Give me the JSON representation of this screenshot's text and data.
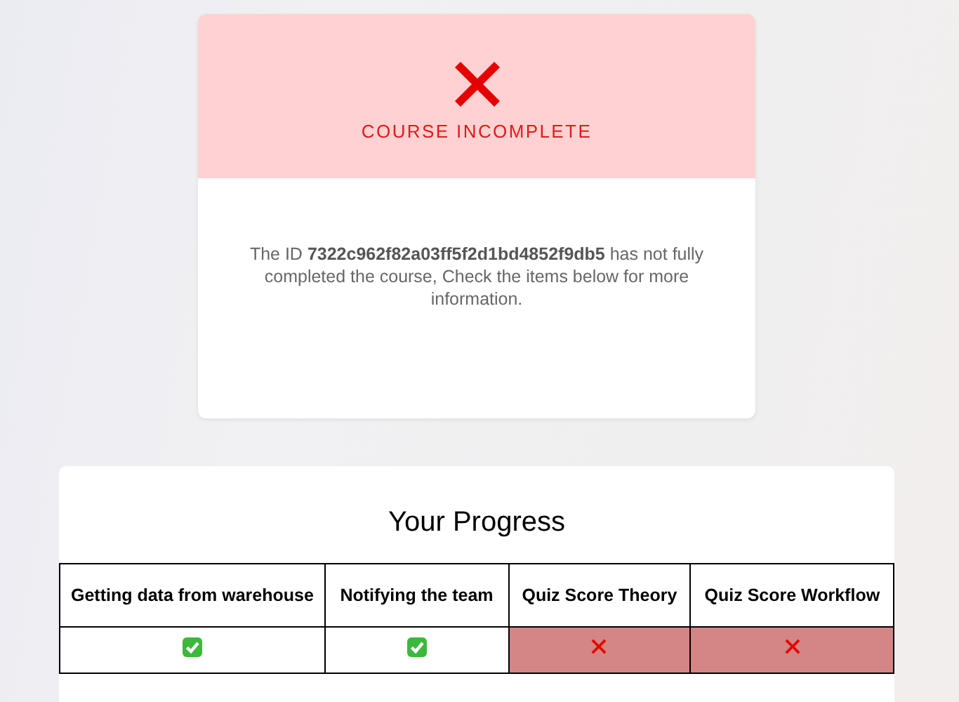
{
  "status_card": {
    "title": "COURSE INCOMPLETE",
    "message": "The ID **7322c962f82a03ff5f2d1bd4852f9db5** has not fully completed the course, Check the items below for more information."
  },
  "progress": {
    "title": "Your Progress",
    "items": [
      {
        "label": "Getting data from warehouse",
        "passed": true
      },
      {
        "label": "Notifying the team",
        "passed": true
      },
      {
        "label": "Quiz Score Theory",
        "passed": false
      },
      {
        "label": "Quiz Score Workflow",
        "passed": false
      }
    ]
  }
}
